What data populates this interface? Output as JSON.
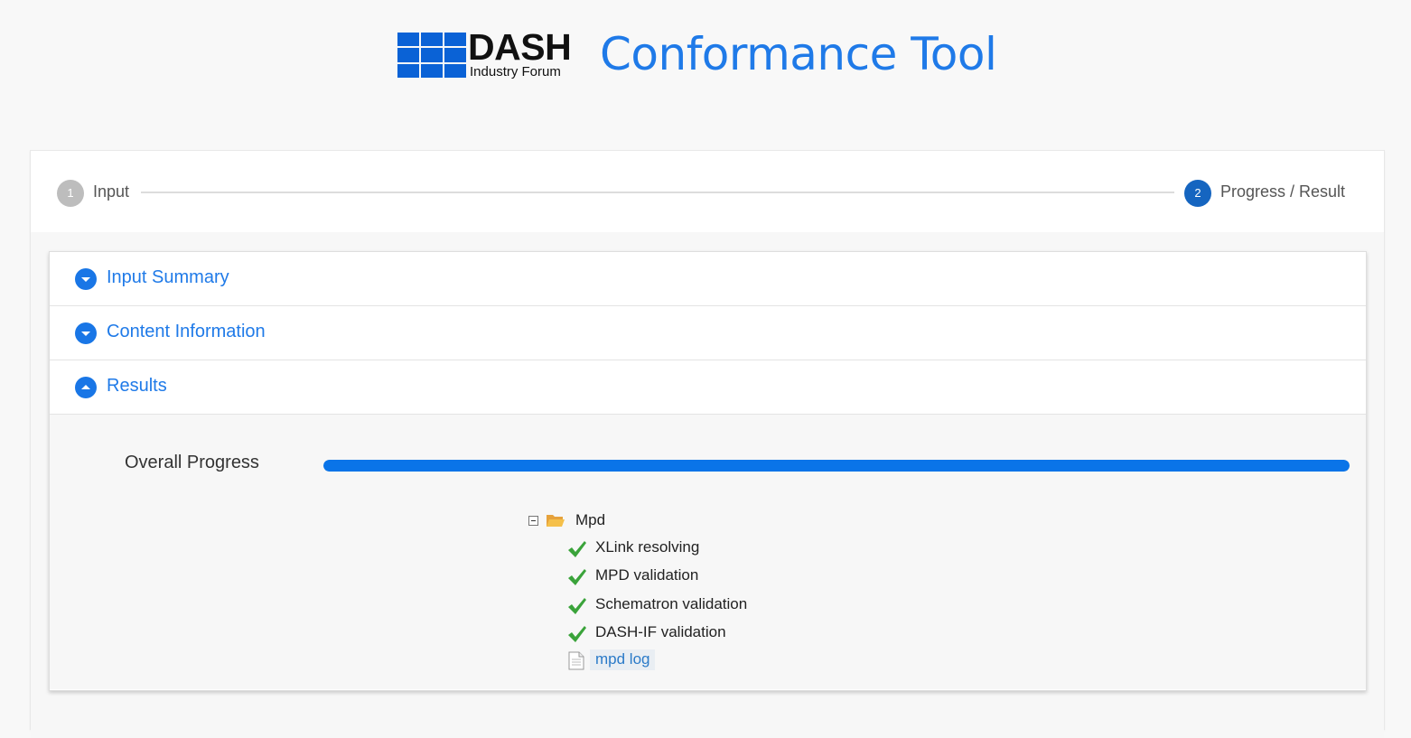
{
  "header": {
    "logo_word": "DASH",
    "logo_subtitle": "Industry Forum",
    "title": "Conformance Tool"
  },
  "stepper": {
    "steps": [
      {
        "number": "1",
        "label": "Input",
        "active": false
      },
      {
        "number": "2",
        "label": "Progress / Result",
        "active": true
      }
    ]
  },
  "accordion": {
    "sections": [
      {
        "title": "Input Summary",
        "expanded": false
      },
      {
        "title": "Content Information",
        "expanded": false
      },
      {
        "title": "Results",
        "expanded": true
      }
    ]
  },
  "results": {
    "progress_label": "Overall Progress",
    "progress_percent": 100,
    "tree": {
      "root_label": "Mpd",
      "items": [
        {
          "label": "XLink resolving",
          "status": "check-icon"
        },
        {
          "label": "MPD validation",
          "status": "check-icon"
        },
        {
          "label": "Schematron validation",
          "status": "check-icon"
        },
        {
          "label": "DASH-IF validation",
          "status": "check-icon"
        }
      ],
      "log_link": "mpd log"
    }
  },
  "colors": {
    "accent": "#1f7ae8",
    "progress": "#0a74e8",
    "check": "#3aa33a",
    "step_active": "#1565c0",
    "step_inactive": "#bdbdbd"
  }
}
